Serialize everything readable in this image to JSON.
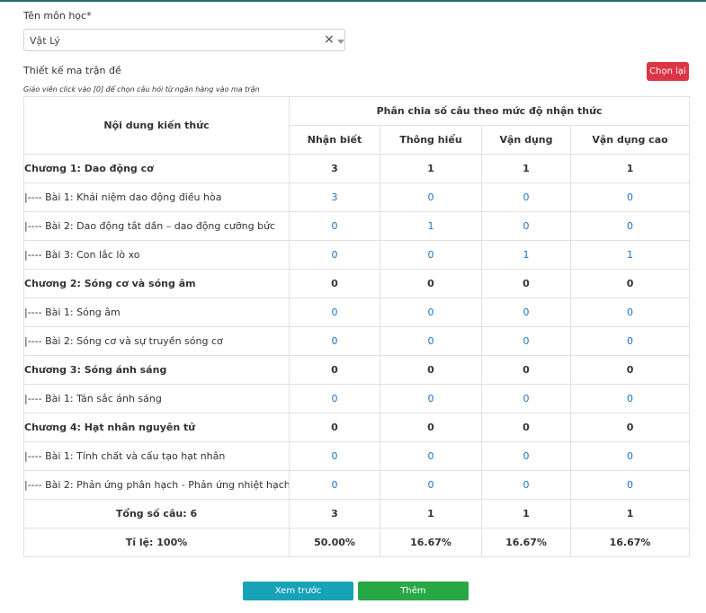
{
  "subject": {
    "label": "Tên môn học*",
    "value": "Vật Lý",
    "clear_glyph": "×"
  },
  "matrix": {
    "title": "Thiết kế ma trận đề",
    "hint": "Giáo viên click vào [0] để chọn câu hỏi từ ngân hàng vào ma trận",
    "reset_label": "Chọn lại",
    "header": {
      "content": "Nội dung kiến thức",
      "group": "Phân chia số câu theo mức độ nhận thức",
      "levels": [
        "Nhận biết",
        "Thông hiểu",
        "Vận dụng",
        "Vận dụng cao"
      ]
    },
    "rows": [
      {
        "kind": "chapter",
        "name": "Chương 1: Dao động cơ",
        "values": [
          "3",
          "1",
          "1",
          "1"
        ]
      },
      {
        "kind": "lesson",
        "name": "|---- Bài 1: Khái niệm dao động điều hòa",
        "values": [
          "3",
          "0",
          "0",
          "0"
        ]
      },
      {
        "kind": "lesson",
        "name": "|---- Bài 2: Dao động tắt dần – dao động cưỡng bức",
        "values": [
          "0",
          "1",
          "0",
          "0"
        ]
      },
      {
        "kind": "lesson",
        "name": "|---- Bài 3: Con lắc lò xo",
        "values": [
          "0",
          "0",
          "1",
          "1"
        ]
      },
      {
        "kind": "chapter",
        "name": "Chương 2: Sóng cơ và sóng âm",
        "values": [
          "0",
          "0",
          "0",
          "0"
        ]
      },
      {
        "kind": "lesson",
        "name": "|---- Bài 1: Sóng âm",
        "values": [
          "0",
          "0",
          "0",
          "0"
        ]
      },
      {
        "kind": "lesson",
        "name": "|---- Bài 2: Sóng cơ và sự truyền sóng cơ",
        "values": [
          "0",
          "0",
          "0",
          "0"
        ]
      },
      {
        "kind": "chapter",
        "name": "Chương 3: Sóng ánh sáng",
        "values": [
          "0",
          "0",
          "0",
          "0"
        ]
      },
      {
        "kind": "lesson",
        "name": "|---- Bài 1: Tán sắc ánh sáng",
        "values": [
          "0",
          "0",
          "0",
          "0"
        ]
      },
      {
        "kind": "chapter",
        "name": "Chương 4: Hạt nhân nguyên tử",
        "values": [
          "0",
          "0",
          "0",
          "0"
        ]
      },
      {
        "kind": "lesson",
        "name": "|---- Bài 1: Tính chất và cấu tạo hạt nhân",
        "values": [
          "0",
          "0",
          "0",
          "0"
        ]
      },
      {
        "kind": "lesson",
        "name": "|---- Bài 2: Phản ứng phân hạch - Phản ứng nhiệt hạch",
        "values": [
          "0",
          "0",
          "0",
          "0"
        ]
      }
    ],
    "total": {
      "label": "Tổng số câu: 6",
      "values": [
        "3",
        "1",
        "1",
        "1"
      ]
    },
    "ratio": {
      "label": "Tỉ lệ: 100%",
      "values": [
        "50.00%",
        "16.67%",
        "16.67%",
        "16.67%"
      ]
    }
  },
  "actions": {
    "preview_label": "Xem trước",
    "add_label": "Thêm"
  },
  "colors": {
    "danger": "#dc3545",
    "info": "#17a2b8",
    "success": "#28a745",
    "link": "#1a73c7"
  }
}
